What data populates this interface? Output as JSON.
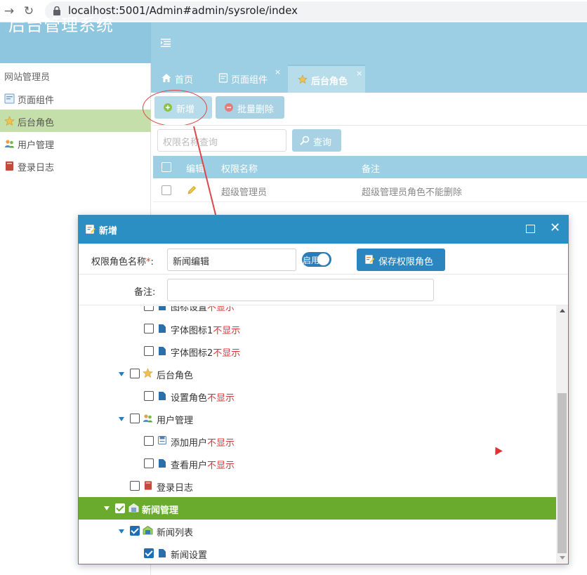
{
  "browser": {
    "url": "localhost:5001/Admin#admin/sysrole/index"
  },
  "app": {
    "title": "后台管理系统"
  },
  "sidebar": {
    "group_label": "网站管理员",
    "items": [
      {
        "label": "页面组件",
        "icon": "page-component-icon"
      },
      {
        "label": "后台角色",
        "icon": "role-star-icon",
        "active": true
      },
      {
        "label": "用户管理",
        "icon": "users-icon"
      },
      {
        "label": "登录日志",
        "icon": "log-book-icon"
      }
    ]
  },
  "tabs": [
    {
      "label": "首页",
      "icon": "home-icon",
      "closable": false
    },
    {
      "label": "页面组件",
      "icon": "page-icon",
      "closable": true
    },
    {
      "label": "后台角色",
      "icon": "role-star-icon",
      "closable": true,
      "active": true
    }
  ],
  "tab_close_glyph": "×",
  "toolbar": {
    "add_label": "新增",
    "batch_delete_label": "批量删除"
  },
  "search": {
    "placeholder": "权限名称查询",
    "button_label": "查询"
  },
  "grid": {
    "columns": [
      "编辑",
      "权限名称",
      "备注"
    ],
    "rows": [
      {
        "name": "超级管理员",
        "remark": "超级管理员角色不能删除"
      }
    ]
  },
  "dialog": {
    "title": "新增",
    "name_label": "权限角色名称",
    "required_mark": "*",
    "name_colon": ":",
    "name_value": "新闻编辑",
    "enabled_label": "启用",
    "enabled": true,
    "save_label": "保存权限角色",
    "remark_label": "备注:",
    "remark_value": ""
  },
  "tree": {
    "hidden_suffix": "不显示",
    "nodes": [
      {
        "label": "图标设置",
        "suffix": "不显示",
        "checked": false,
        "partial": true
      },
      {
        "label": "字体图标1",
        "suffix": "不显示",
        "checked": false
      },
      {
        "label": "字体图标2",
        "suffix": "不显示",
        "checked": false
      },
      {
        "label": "后台角色",
        "suffix": "",
        "checked": false,
        "expanded": true
      },
      {
        "label": "设置角色",
        "suffix": "不显示",
        "checked": false
      },
      {
        "label": "用户管理",
        "suffix": "",
        "checked": false,
        "expanded": true
      },
      {
        "label": "添加用户",
        "suffix": "不显示",
        "checked": false
      },
      {
        "label": "查看用户",
        "suffix": "不显示",
        "checked": false
      },
      {
        "label": "登录日志",
        "suffix": "",
        "checked": false
      },
      {
        "label": "新闻管理",
        "suffix": "",
        "checked": true,
        "expanded": true,
        "selected": true
      },
      {
        "label": "新闻列表",
        "suffix": "",
        "checked": true,
        "expanded": true
      },
      {
        "label": "新闻设置",
        "suffix": "",
        "checked": true
      }
    ]
  },
  "colors": {
    "header": "#9ccfe3",
    "dialog_header": "#2b8fc4",
    "selected_row": "#6aab2e",
    "active_sidebar": "#c4dfa9",
    "hidden_text": "#e03131",
    "annotation": "#d94949"
  }
}
